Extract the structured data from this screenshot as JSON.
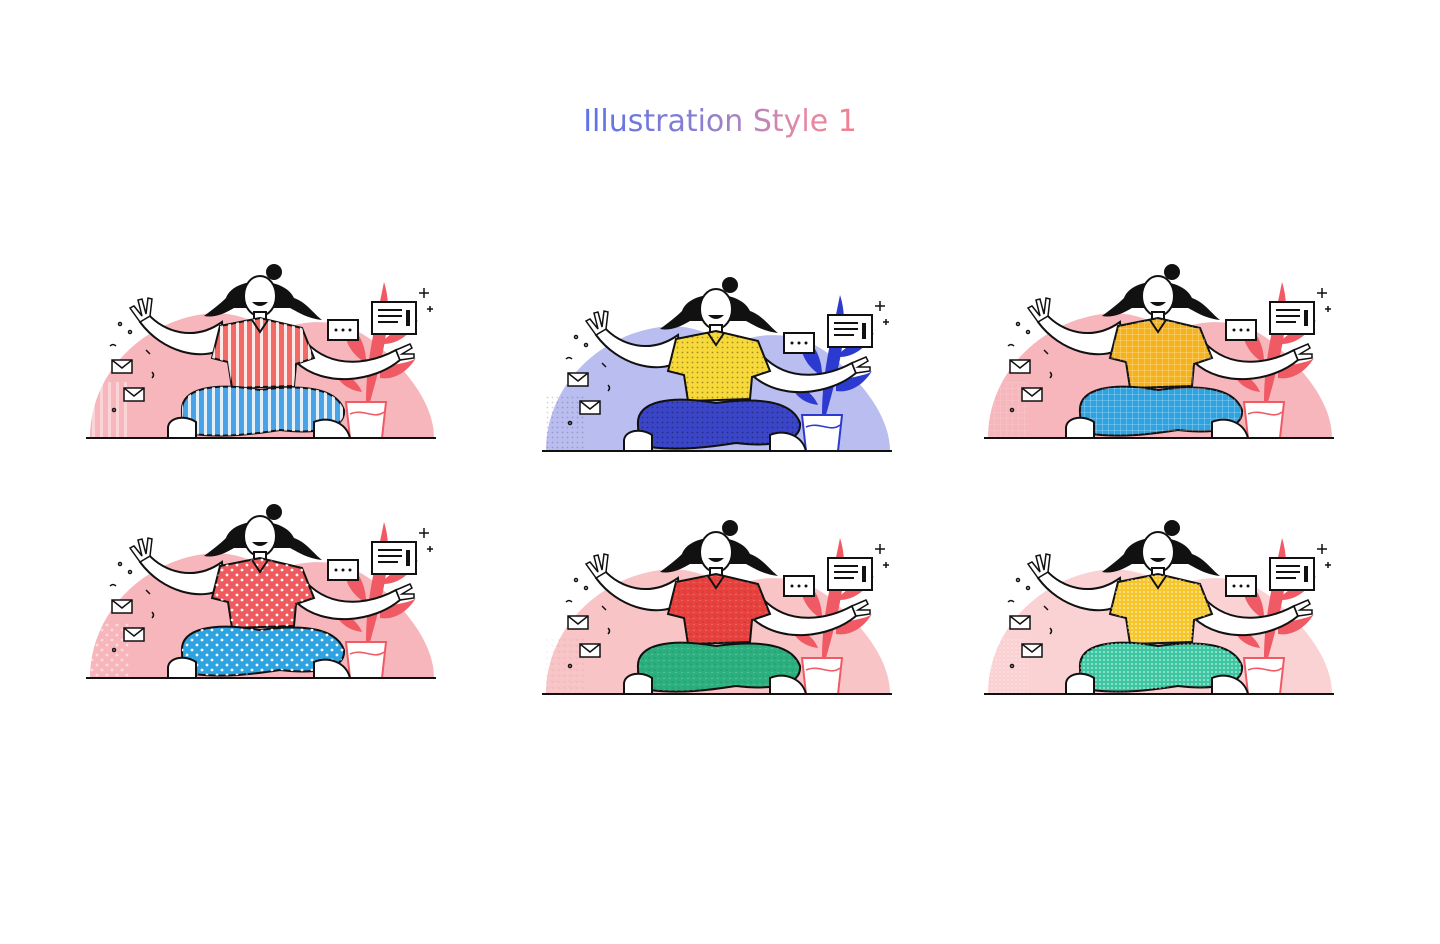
{
  "title": "Illustration Style 1",
  "variants": [
    {
      "bg": "#f6b6bb",
      "shirt": "#f26a66",
      "pants": "#4aa3e6",
      "plant": "#ef5a64",
      "pattern": "stripes"
    },
    {
      "bg": "#b9bdf0",
      "shirt": "#f8d93a",
      "pants": "#3a46c7",
      "plant": "#2d3ad0",
      "pattern": "dots"
    },
    {
      "bg": "#f6b6bb",
      "shirt": "#f5b21c",
      "pants": "#2ea3e2",
      "plant": "#ef5a64",
      "pattern": "grid"
    },
    {
      "bg": "#f6b6bb",
      "shirt": "#ef5a5e",
      "pants": "#2ea3e2",
      "plant": "#ef5a64",
      "pattern": "polka"
    },
    {
      "bg": "#f8c4c6",
      "shirt": "#e8413e",
      "pants": "#2bb07f",
      "plant": "#ef5a64",
      "pattern": "noise"
    },
    {
      "bg": "#fbd2d4",
      "shirt": "#f7c62a",
      "pants": "#3cc7a2",
      "plant": "#ef5a64",
      "pattern": "halftone"
    }
  ]
}
